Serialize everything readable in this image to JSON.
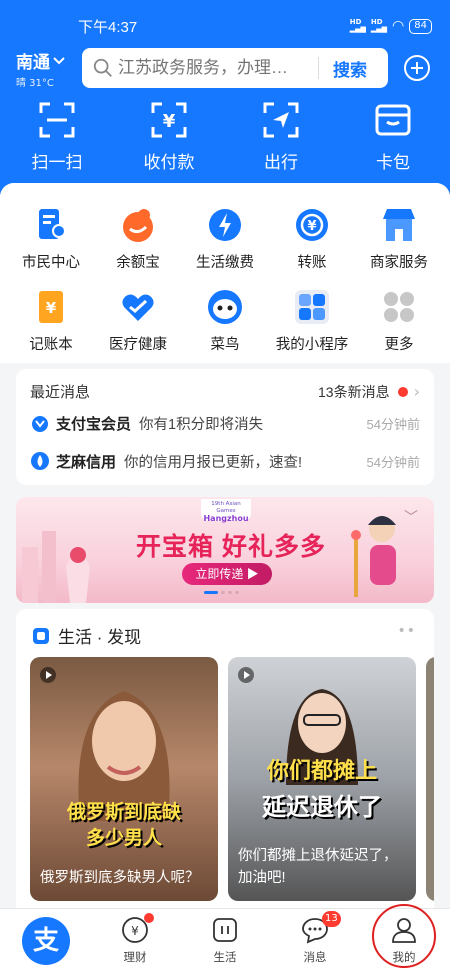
{
  "status_bar": {
    "time": "下午4:37",
    "battery": "84"
  },
  "header": {
    "city": "南通",
    "weather": "晴 31°C",
    "search_placeholder": "江苏政务服务，办理…",
    "search_button": "搜索"
  },
  "quick_actions": [
    {
      "label": "扫一扫",
      "icon": "scan-icon"
    },
    {
      "label": "收付款",
      "icon": "payment-icon"
    },
    {
      "label": "出行",
      "icon": "travel-icon"
    },
    {
      "label": "卡包",
      "icon": "wallet-icon"
    }
  ],
  "services": [
    {
      "label": "市民中心",
      "icon": "citizen-center-icon"
    },
    {
      "label": "余额宝",
      "icon": "yuebao-icon"
    },
    {
      "label": "生活缴费",
      "icon": "bill-pay-icon"
    },
    {
      "label": "转账",
      "icon": "transfer-icon"
    },
    {
      "label": "商家服务",
      "icon": "merchant-icon"
    },
    {
      "label": "记账本",
      "icon": "ledger-icon"
    },
    {
      "label": "医疗健康",
      "icon": "health-icon"
    },
    {
      "label": "菜鸟",
      "icon": "cainiao-icon"
    },
    {
      "label": "我的小程序",
      "icon": "mini-program-icon"
    },
    {
      "label": "更多",
      "icon": "more-icon"
    }
  ],
  "messages": {
    "title": "最近消息",
    "count": "13条新消息",
    "items": [
      {
        "source": "支付宝会员",
        "text": "你有1积分即将消失",
        "time": "54分钟前"
      },
      {
        "source": "芝麻信用",
        "text": "你的信用月报已更新，速查!",
        "time": "54分钟前"
      }
    ]
  },
  "banner": {
    "tag_line1": "19th Asian Games",
    "tag_line2": "Hangzhou",
    "title": "开宝箱 好礼多多",
    "button": "立即传递 ▶"
  },
  "discover": {
    "title": "生活 · 发现",
    "cards": [
      {
        "overlay1": "俄罗斯到底缺",
        "overlay2": "多少男人",
        "caption": "俄罗斯到底多缺男人呢？"
      },
      {
        "overlay1": "你们都摊上",
        "overlay2": "延迟退休了",
        "caption": "你们都摊上退休延迟了，加油吧!"
      }
    ]
  },
  "tabbar": {
    "home": "支",
    "items": [
      {
        "label": "理财"
      },
      {
        "label": "生活"
      },
      {
        "label": "消息",
        "badge": "13"
      },
      {
        "label": "我的"
      }
    ]
  },
  "colors": {
    "brand": "#1677ff",
    "badge": "#ff3b30",
    "banner_accent": "#e6245a"
  }
}
